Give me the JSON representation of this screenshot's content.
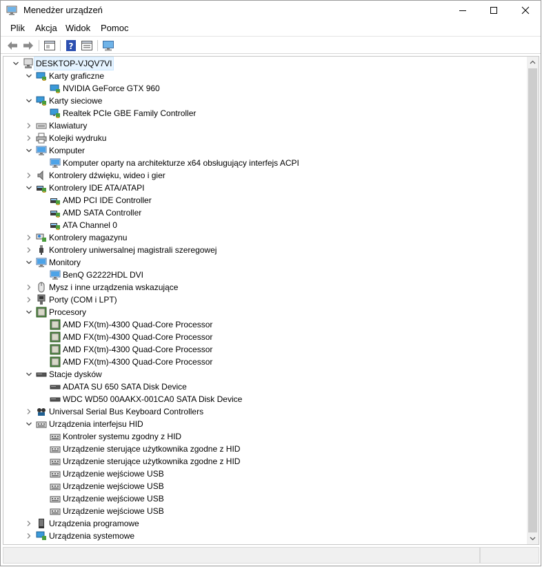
{
  "window": {
    "title": "Menedżer urządzeń",
    "accent": "#0078d7"
  },
  "menu": [
    "Plik",
    "Akcja",
    "Widok",
    "Pomoc"
  ],
  "toolbar": {
    "buttons": [
      "back-arrow-icon",
      "forward-arrow-icon",
      "properties-icon",
      "help-icon",
      "details-icon",
      "monitor-scan-icon"
    ]
  },
  "tree": {
    "root": "DESKTOP-VJQV7VI",
    "categories": [
      {
        "label": "Karty graficzne",
        "icon": "display-adapter-icon",
        "expanded": true,
        "children": [
          "NVIDIA GeForce GTX 960"
        ]
      },
      {
        "label": "Karty sieciowe",
        "icon": "network-adapter-icon",
        "expanded": true,
        "children": [
          "Realtek PCIe GBE Family Controller"
        ]
      },
      {
        "label": "Klawiatury",
        "icon": "keyboard-icon",
        "expanded": false,
        "children": []
      },
      {
        "label": "Kolejki wydruku",
        "icon": "printer-icon",
        "expanded": false,
        "children": []
      },
      {
        "label": "Komputer",
        "icon": "computer-icon",
        "expanded": true,
        "children": [
          "Komputer oparty na architekturze x64 obsługujący interfejs ACPI"
        ]
      },
      {
        "label": "Kontrolery dźwięku, wideo i gier",
        "icon": "speaker-icon",
        "expanded": false,
        "children": []
      },
      {
        "label": "Kontrolery IDE ATA/ATAPI",
        "icon": "ide-controller-icon",
        "expanded": true,
        "children": [
          "AMD PCI IDE Controller",
          "AMD SATA Controller",
          "ATA Channel 0"
        ]
      },
      {
        "label": "Kontrolery magazynu",
        "icon": "storage-controller-icon",
        "expanded": false,
        "children": []
      },
      {
        "label": "Kontrolery uniwersalnej magistrali szeregowej",
        "icon": "usb-plug-icon",
        "expanded": false,
        "children": []
      },
      {
        "label": "Monitory",
        "icon": "monitor-icon",
        "expanded": true,
        "children": [
          "BenQ G2222HDL DVI"
        ]
      },
      {
        "label": "Mysz i inne urządzenia wskazujące",
        "icon": "mouse-icon",
        "expanded": false,
        "children": []
      },
      {
        "label": "Porty (COM i LPT)",
        "icon": "port-icon",
        "expanded": false,
        "children": []
      },
      {
        "label": "Procesory",
        "icon": "processor-icon",
        "expanded": true,
        "children": [
          "AMD FX(tm)-4300 Quad-Core Processor",
          "AMD FX(tm)-4300 Quad-Core Processor",
          "AMD FX(tm)-4300 Quad-Core Processor",
          "AMD FX(tm)-4300 Quad-Core Processor"
        ]
      },
      {
        "label": "Stacje dysków",
        "icon": "disk-drive-icon",
        "expanded": true,
        "children": [
          "ADATA SU 650 SATA Disk Device",
          "WDC WD50 00AAKX-001CA0 SATA Disk Device"
        ]
      },
      {
        "label": "Universal Serial Bus Keyboard Controllers",
        "icon": "usb-keyboard-controller-icon",
        "expanded": false,
        "children": []
      },
      {
        "label": "Urządzenia interfejsu HID",
        "icon": "hid-icon",
        "expanded": true,
        "children": [
          "Kontroler systemu zgodny z HID",
          "Urządzenie sterujące użytkownika zgodne z HID",
          "Urządzenie sterujące użytkownika zgodne z HID",
          "Urządzenie wejściowe USB",
          "Urządzenie wejściowe USB",
          "Urządzenie wejściowe USB",
          "Urządzenie wejściowe USB"
        ]
      },
      {
        "label": "Urządzenia programowe",
        "icon": "software-device-icon",
        "expanded": false,
        "children": []
      },
      {
        "label": "Urządzenia systemowe",
        "icon": "system-device-icon",
        "expanded": false,
        "children": []
      }
    ]
  }
}
